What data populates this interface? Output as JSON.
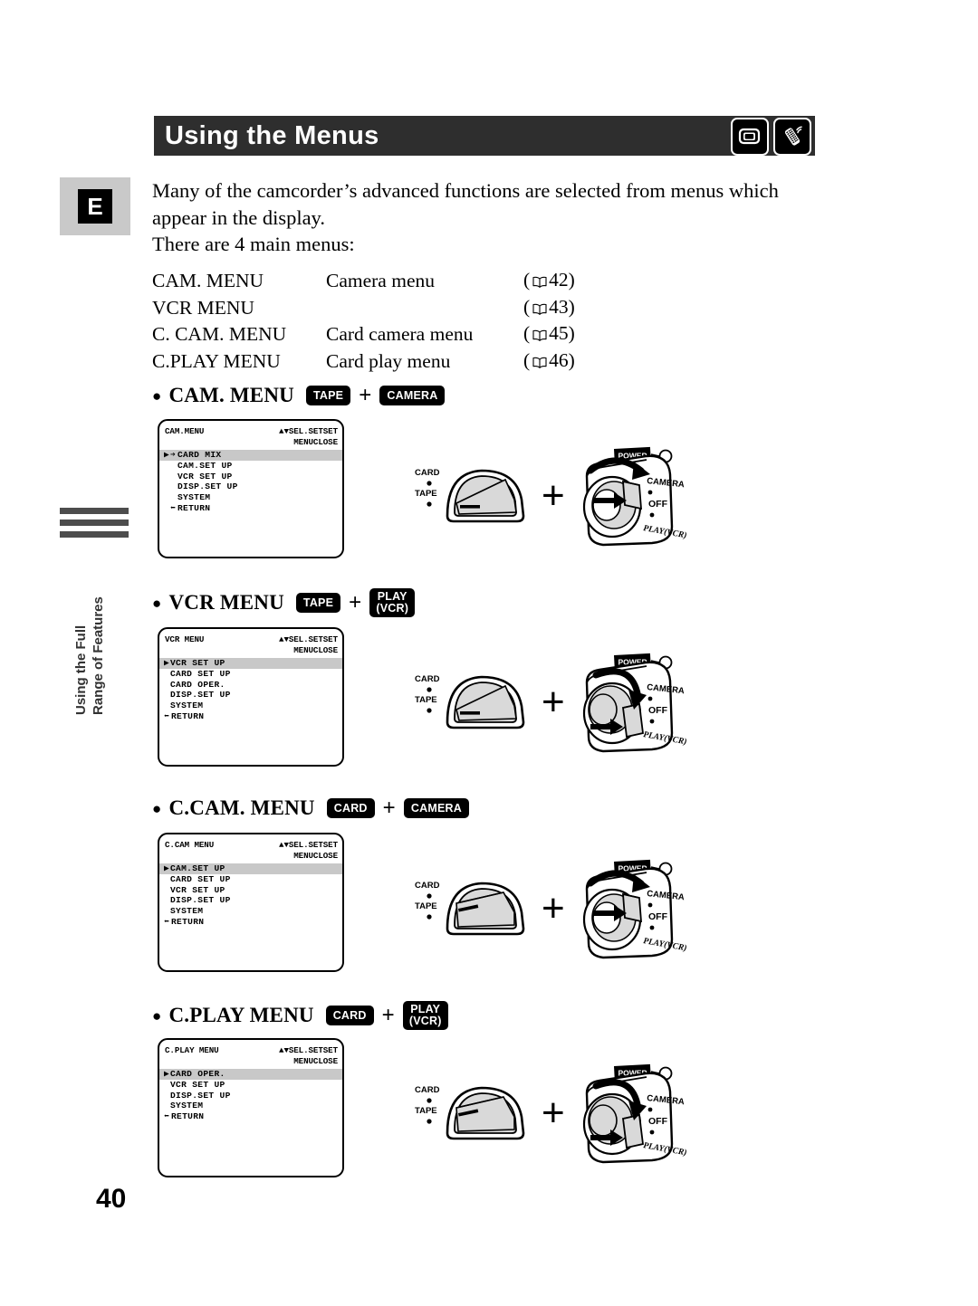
{
  "header": {
    "title": "Using the Menus",
    "icons": [
      "camcorder-icon",
      "remote-control-icon"
    ]
  },
  "language_tab": {
    "label": "E"
  },
  "sidebar": {
    "vertical_text_line1": "Using the Full",
    "vertical_text_line2": "Range of Features"
  },
  "intro": {
    "paragraph": "Many of the camcorder’s advanced functions are selected from menus which appear in the display.",
    "subheading": "There are 4 main menus:"
  },
  "menu_table": {
    "rows": [
      {
        "name": "CAM. MENU",
        "desc": "Camera menu",
        "page": "42"
      },
      {
        "name": "VCR MENU",
        "desc": "",
        "page": "43"
      },
      {
        "name": "C. CAM. MENU",
        "desc": "Card camera menu",
        "page": "45"
      },
      {
        "name": "C.PLAY MENU",
        "desc": "Card play menu",
        "page": "46"
      }
    ]
  },
  "sections": [
    {
      "heading": "CAM. MENU",
      "badge1": "TAPE",
      "badge2_line1": "CAMERA",
      "badge2_line2": "",
      "plus": "+",
      "lcd": {
        "title": "CAM.MENU",
        "hint_line1": "▲▼SEL.SETSET",
        "hint_line2": "MENUCLOSE",
        "items": [
          {
            "label": "CARD MIX",
            "selected": true,
            "cursor": "▶",
            "arrow": "➔"
          },
          {
            "label": "CAM.SET UP",
            "selected": false,
            "cursor": "",
            "arrow": ""
          },
          {
            "label": "VCR SET UP",
            "selected": false,
            "cursor": "",
            "arrow": ""
          },
          {
            "label": "DISP.SET UP",
            "selected": false,
            "cursor": "",
            "arrow": ""
          },
          {
            "label": "SYSTEM",
            "selected": false,
            "cursor": "",
            "arrow": ""
          },
          {
            "label": "RETURN",
            "selected": false,
            "cursor": "",
            "arrow": "⬅"
          }
        ]
      },
      "dial": {
        "top_label": "CARD",
        "bottom_label": "TAPE",
        "selected": "TAPE"
      },
      "power": {
        "label": "POWER",
        "positions": [
          "CAMERA",
          "OFF",
          "PLAY(VCR)"
        ],
        "selected": "CAMERA"
      }
    },
    {
      "heading": "VCR MENU",
      "badge1": "TAPE",
      "badge2_line1": "PLAY",
      "badge2_line2": "(VCR)",
      "plus": "+",
      "lcd": {
        "title": "VCR MENU",
        "hint_line1": "▲▼SEL.SETSET",
        "hint_line2": "MENUCLOSE",
        "items": [
          {
            "label": "VCR SET UP",
            "selected": true,
            "cursor": "▶",
            "arrow": ""
          },
          {
            "label": "CARD SET UP",
            "selected": false,
            "cursor": "",
            "arrow": ""
          },
          {
            "label": "CARD OPER.",
            "selected": false,
            "cursor": "",
            "arrow": ""
          },
          {
            "label": "DISP.SET UP",
            "selected": false,
            "cursor": "",
            "arrow": ""
          },
          {
            "label": "SYSTEM",
            "selected": false,
            "cursor": "",
            "arrow": ""
          },
          {
            "label": "RETURN",
            "selected": false,
            "cursor": "",
            "arrow": "⬅"
          }
        ]
      },
      "dial": {
        "top_label": "CARD",
        "bottom_label": "TAPE",
        "selected": "TAPE"
      },
      "power": {
        "label": "POWER",
        "positions": [
          "CAMERA",
          "OFF",
          "PLAY(VCR)"
        ],
        "selected": "PLAY(VCR)"
      }
    },
    {
      "heading": "C.CAM. MENU",
      "badge1": "CARD",
      "badge2_line1": "CAMERA",
      "badge2_line2": "",
      "plus": "+",
      "lcd": {
        "title": "C.CAM MENU",
        "hint_line1": "▲▼SEL.SETSET",
        "hint_line2": "MENUCLOSE",
        "items": [
          {
            "label": "CAM.SET UP",
            "selected": true,
            "cursor": "▶",
            "arrow": ""
          },
          {
            "label": "CARD SET UP",
            "selected": false,
            "cursor": "",
            "arrow": ""
          },
          {
            "label": "VCR SET UP",
            "selected": false,
            "cursor": "",
            "arrow": ""
          },
          {
            "label": "DISP.SET UP",
            "selected": false,
            "cursor": "",
            "arrow": ""
          },
          {
            "label": "SYSTEM",
            "selected": false,
            "cursor": "",
            "arrow": ""
          },
          {
            "label": "RETURN",
            "selected": false,
            "cursor": "",
            "arrow": "⬅"
          }
        ]
      },
      "dial": {
        "top_label": "CARD",
        "bottom_label": "TAPE",
        "selected": "CARD"
      },
      "power": {
        "label": "POWER",
        "positions": [
          "CAMERA",
          "OFF",
          "PLAY(VCR)"
        ],
        "selected": "CAMERA"
      }
    },
    {
      "heading": "C.PLAY MENU",
      "badge1": "CARD",
      "badge2_line1": "PLAY",
      "badge2_line2": "(VCR)",
      "plus": "+",
      "lcd": {
        "title": "C.PLAY MENU",
        "hint_line1": "▲▼SEL.SETSET",
        "hint_line2": "MENUCLOSE",
        "items": [
          {
            "label": "CARD OPER.",
            "selected": true,
            "cursor": "▶",
            "arrow": ""
          },
          {
            "label": "VCR SET UP",
            "selected": false,
            "cursor": "",
            "arrow": ""
          },
          {
            "label": "DISP.SET UP",
            "selected": false,
            "cursor": "",
            "arrow": ""
          },
          {
            "label": "SYSTEM",
            "selected": false,
            "cursor": "",
            "arrow": ""
          },
          {
            "label": "RETURN",
            "selected": false,
            "cursor": "",
            "arrow": "⬅"
          }
        ]
      },
      "dial": {
        "top_label": "CARD",
        "bottom_label": "TAPE",
        "selected": "CARD"
      },
      "power": {
        "label": "POWER",
        "positions": [
          "CAMERA",
          "OFF",
          "PLAY(VCR)"
        ],
        "selected": "PLAY(VCR)"
      }
    }
  ],
  "page_number": "40",
  "colors": {
    "header_bg": "#2e2e2e",
    "tab_bg": "#c9c9c9",
    "highlight": "#c8c8c8"
  }
}
